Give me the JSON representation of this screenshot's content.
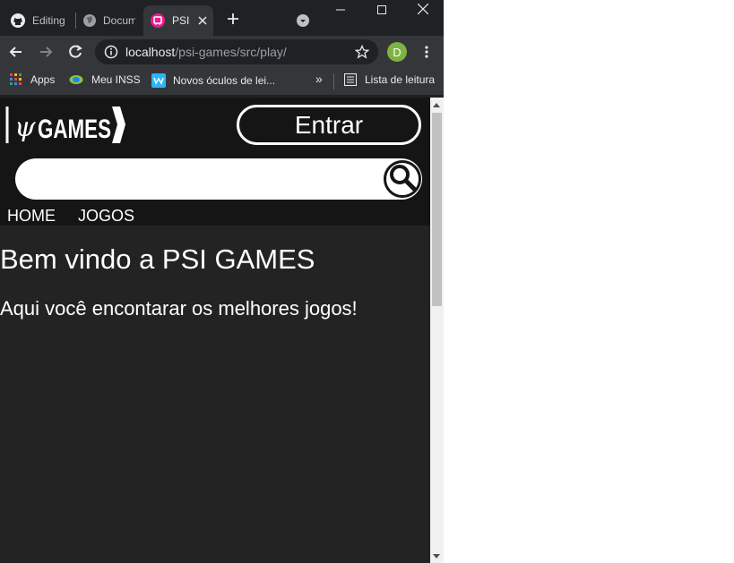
{
  "browser": {
    "tabs": [
      {
        "title": "Editing",
        "icon": "github-icon"
      },
      {
        "title": "Docum",
        "icon": "globe-icon"
      },
      {
        "title": "PSI",
        "icon": "psi-favicon",
        "active": true
      }
    ],
    "url_host": "localhost",
    "url_path": "/psi-games/src/play/",
    "profile_initial": "D",
    "profile_color": "#7cb342",
    "bookmarks": {
      "apps": "Apps",
      "meu_inss": "Meu INSS",
      "novos_oculos": "Novos óculos de lei...",
      "more": "»",
      "lista_leitura": "Lista de leitura"
    }
  },
  "site": {
    "logo_text": "GAMES",
    "logo_symbol": "ψ",
    "login_button": "Entrar",
    "search_placeholder": "",
    "nav": [
      "HOME",
      "JOGOS"
    ],
    "welcome": "Bem vindo a PSI GAMES",
    "subtitle": "Aqui você encontarar os melhores jogos!"
  },
  "colors": {
    "chrome_dark": "#202124",
    "chrome_toolbar": "#35363a",
    "site_header": "#151515",
    "site_body": "#232323",
    "psi_accent": "#e91e8c"
  }
}
